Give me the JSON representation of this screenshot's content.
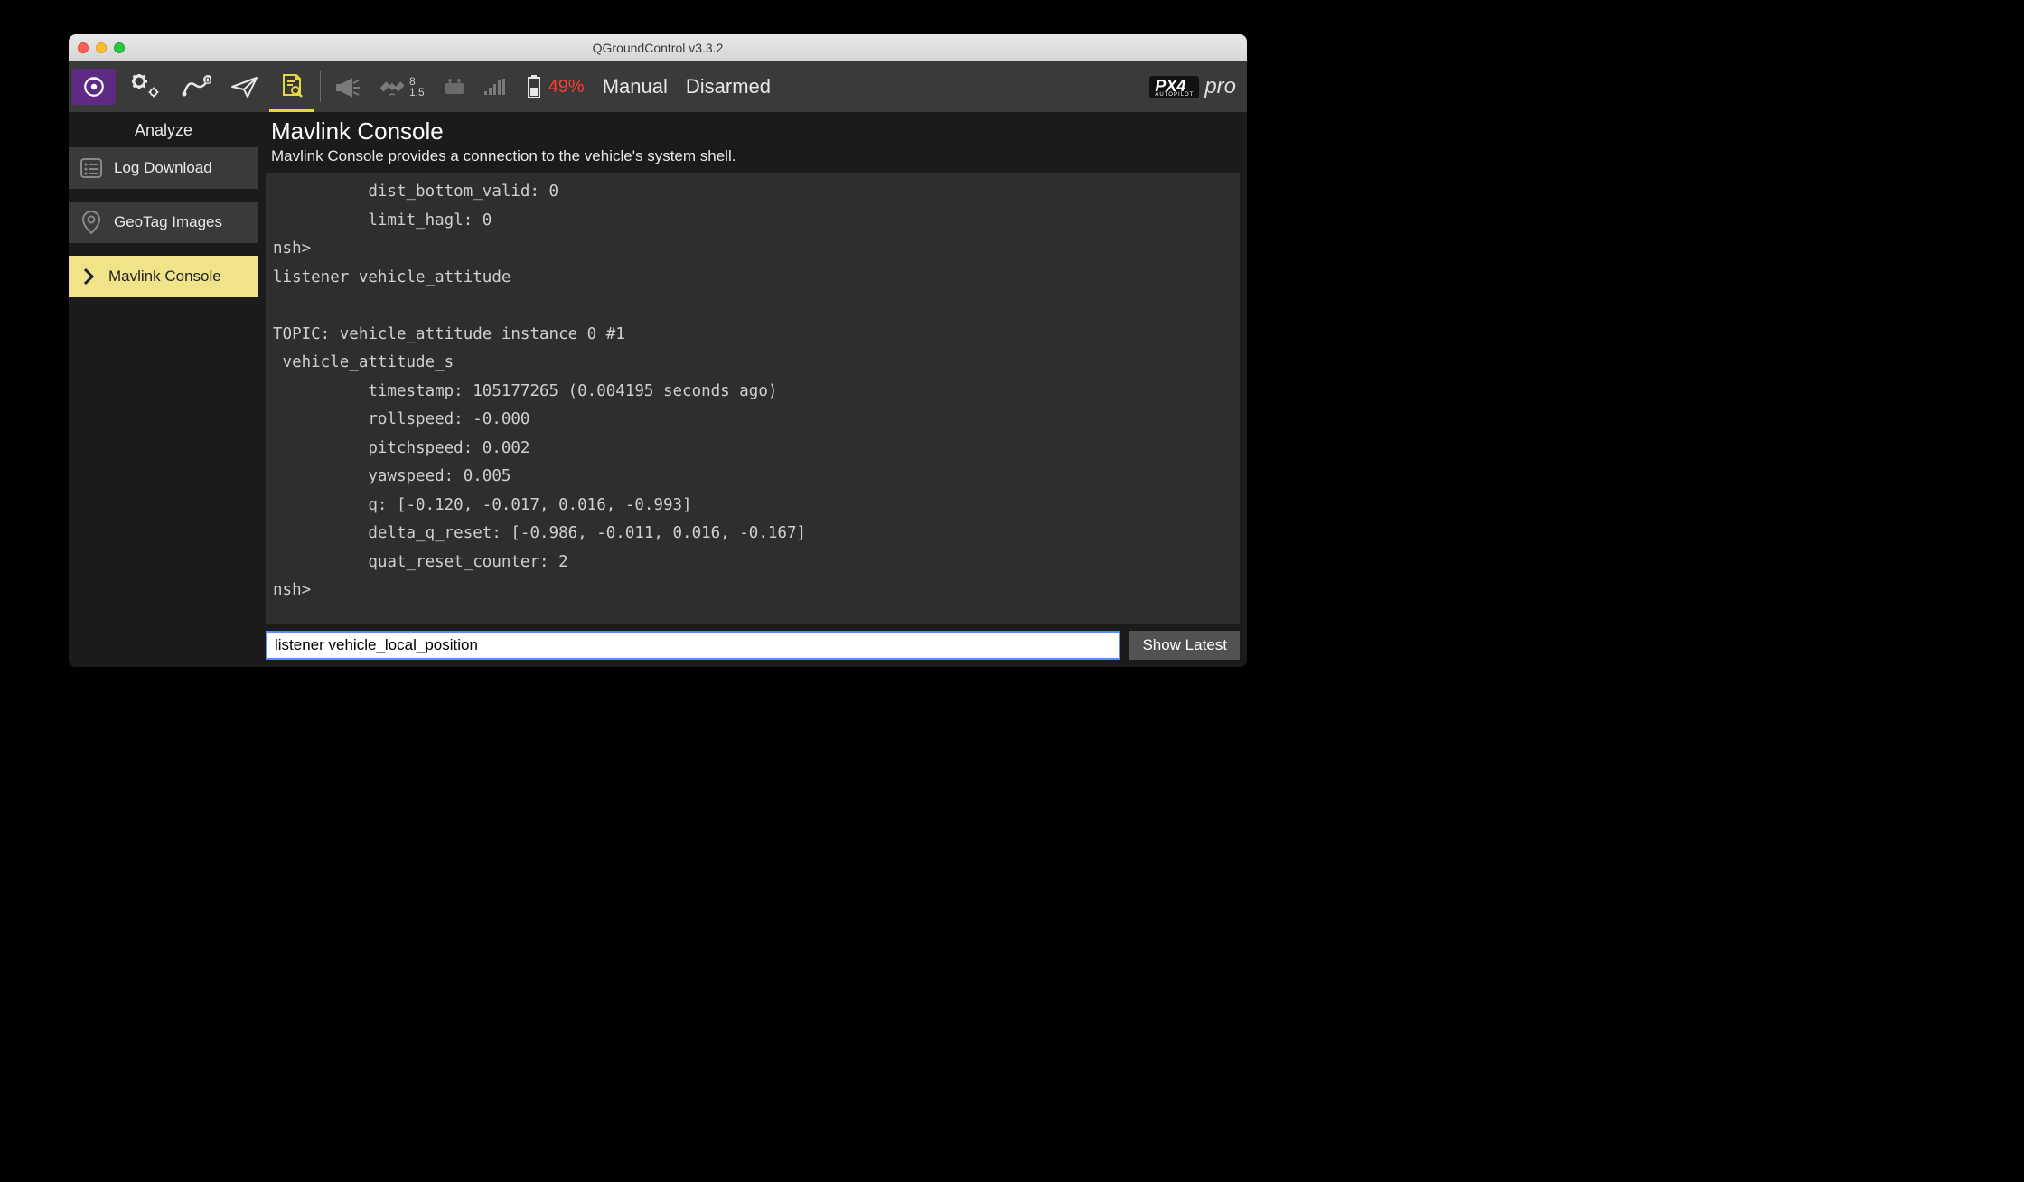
{
  "window": {
    "title": "QGroundControl v3.3.2"
  },
  "toolbar": {
    "gps": {
      "sat_count": "8",
      "hdop": "1.5"
    },
    "battery_pct": "49%",
    "flight_mode": "Manual",
    "arm_state": "Disarmed",
    "brand_badge": "PX4",
    "brand_sub": "AUTOPILOT",
    "brand_suffix": "pro"
  },
  "sidebar": {
    "title": "Analyze",
    "items": [
      {
        "label": "Log Download"
      },
      {
        "label": "GeoTag Images"
      },
      {
        "label": "Mavlink Console"
      }
    ]
  },
  "main": {
    "title": "Mavlink Console",
    "subtitle": "Mavlink Console provides a connection to the vehicle's system shell."
  },
  "console_text": "          dist_bottom_valid: 0\n          limit_hagl: 0\nnsh>\nlistener vehicle_attitude\n\nTOPIC: vehicle_attitude instance 0 #1\n vehicle_attitude_s\n          timestamp: 105177265 (0.004195 seconds ago)\n          rollspeed: -0.000\n          pitchspeed: 0.002\n          yawspeed: 0.005\n          q: [-0.120, -0.017, 0.016, -0.993]\n          delta_q_reset: [-0.986, -0.011, 0.016, -0.167]\n          quat_reset_counter: 2\nnsh>",
  "input": {
    "value": "listener vehicle_local_position",
    "button": "Show Latest"
  }
}
